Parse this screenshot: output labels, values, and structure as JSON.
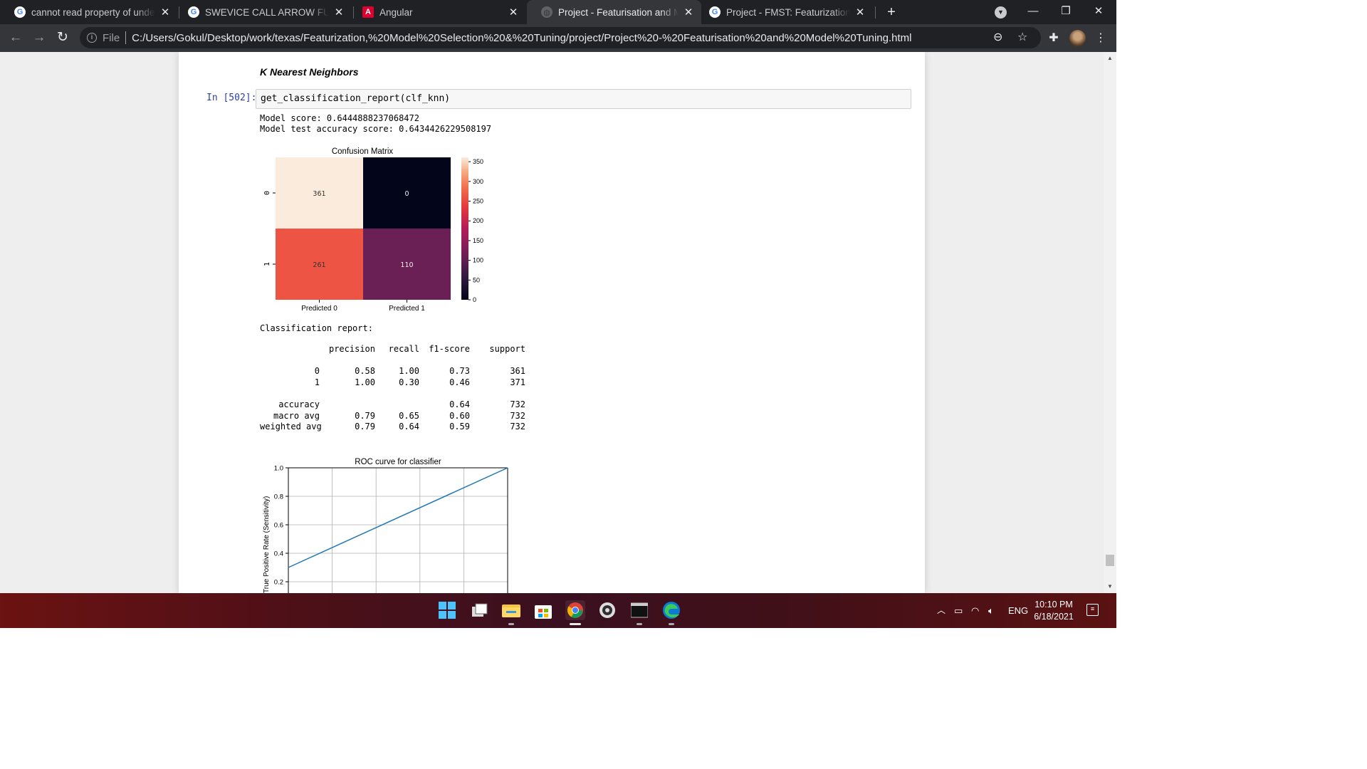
{
  "browser": {
    "tabs": [
      {
        "title": "cannot read property of undefine",
        "icon": "google-icon",
        "active": false
      },
      {
        "title": "SWEVICE CALL ARROW FUNCTIO",
        "icon": "google-icon",
        "active": false
      },
      {
        "title": "Angular",
        "icon": "angular-icon",
        "active": false
      },
      {
        "title": "Project - Featurisation and Mode",
        "icon": "globe-icon",
        "active": true
      },
      {
        "title": "Project - FMST: Featurization, Mo",
        "icon": "google-icon",
        "active": false
      }
    ],
    "address": {
      "scheme_label": "File",
      "url": "C:/Users/Gokul/Desktop/work/texas/Featurization,%20Model%20Selection%20&%20Tuning/project/Project%20-%20Featurisation%20and%20Model%20Tuning.html"
    }
  },
  "notebook": {
    "section_heading": "K Nearest Neighbors",
    "cell_prompt": "In [502]:",
    "cell_code": "get_classification_report(clf_knn)",
    "output_lines": [
      "Model score: 0.6444888237068472",
      "Model test accuracy score: 0.6434426229508197"
    ],
    "report_title": "Classification report:",
    "report": {
      "headers": [
        "precision",
        "recall",
        "f1-score",
        "support"
      ],
      "rows": [
        {
          "label": "0",
          "cells": [
            "0.58",
            "1.00",
            "0.73",
            "361"
          ]
        },
        {
          "label": "1",
          "cells": [
            "1.00",
            "0.30",
            "0.46",
            "371"
          ]
        },
        {
          "label": "accuracy",
          "cells": [
            "",
            "",
            "0.64",
            "732"
          ]
        },
        {
          "label": "macro avg",
          "cells": [
            "0.79",
            "0.65",
            "0.60",
            "732"
          ]
        },
        {
          "label": "weighted avg",
          "cells": [
            "0.79",
            "0.64",
            "0.59",
            "732"
          ]
        }
      ]
    }
  },
  "chart_data": [
    {
      "type": "heatmap",
      "title": "Confusion Matrix",
      "x_categories": [
        "Predicted 0",
        "Predicted 1"
      ],
      "y_categories": [
        "0",
        "1"
      ],
      "values": [
        [
          361,
          0
        ],
        [
          261,
          110
        ]
      ],
      "colorbar": {
        "min": 0,
        "max": 361,
        "ticks": [
          0,
          50,
          100,
          150,
          200,
          250,
          300,
          350
        ],
        "colormap": "rocket"
      }
    },
    {
      "type": "line",
      "title": "ROC curve for classifier",
      "xlabel": "",
      "ylabel": "True Positive Rate (Sensitivity)",
      "xlim": [
        0,
        1
      ],
      "ylim": [
        0,
        1
      ],
      "grid": true,
      "x": [
        0,
        1
      ],
      "y": [
        0.3,
        1.0
      ],
      "yticks": [
        "0.2",
        "0.4",
        "0.6",
        "0.8",
        "1.0"
      ],
      "color": "#1f77b4"
    }
  ],
  "taskbar": {
    "language": "ENG",
    "time": "10:10 PM",
    "date": "6/18/2021"
  }
}
